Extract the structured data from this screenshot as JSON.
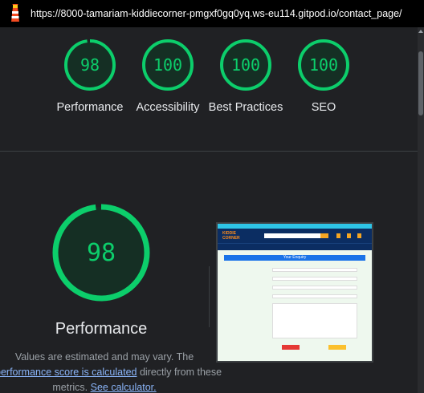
{
  "browser": {
    "url": "https://8000-tamariam-kiddiecorner-pmgxf0gq0yq.ws-eu114.gitpod.io/contact_page/"
  },
  "summary_gauges": [
    {
      "score": "98",
      "label": "Performance",
      "value": 98
    },
    {
      "score": "100",
      "label": "Accessibility",
      "value": 100
    },
    {
      "score": "100",
      "label": "Best Practices",
      "value": 100
    },
    {
      "score": "100",
      "label": "SEO",
      "value": 100
    }
  ],
  "performance": {
    "score": "98",
    "value": 98,
    "title": "Performance",
    "desc_line1": "Values are estimated and may vary. The",
    "desc_link1": "performance score is calculated",
    "desc_mid": " directly from these",
    "desc_line3_pre": "metrics. ",
    "desc_link2": "See calculator."
  },
  "colors": {
    "pass": "#0cce6b",
    "background": "#202124",
    "link": "#8ab4f8"
  },
  "screenshot_preview": {
    "heading": "Your Enquiry",
    "logo": "KIDDIE CORNER"
  }
}
